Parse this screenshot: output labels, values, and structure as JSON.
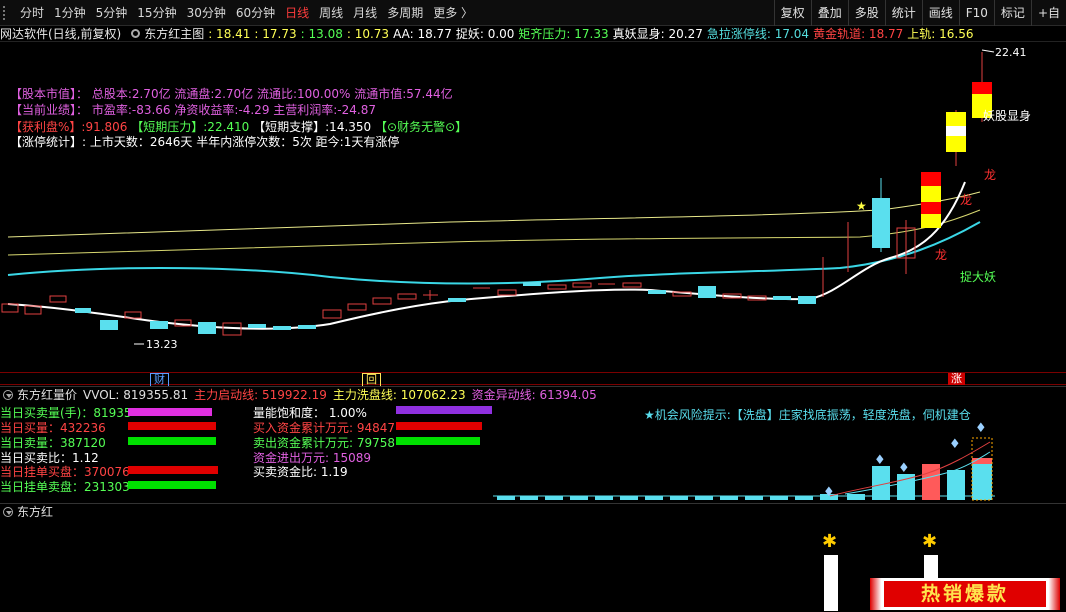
{
  "toolbar": {
    "left_items": [
      "分时",
      "1分钟",
      "5分钟",
      "15分钟",
      "30分钟",
      "60分钟",
      "日线",
      "周线",
      "月线",
      "多周期",
      "更多 〉"
    ],
    "active": "日线",
    "right_items": [
      "复权",
      "叠加",
      "多股",
      "统计",
      "画线",
      "F10",
      "标记",
      "+自"
    ]
  },
  "infobar": {
    "stock": "网达软件(日线,前复权)",
    "indicator": "东方红主图",
    "values": [
      {
        "text": ": 18.41",
        "color": "#ffff55"
      },
      {
        "text": ": 17.73",
        "color": "#ffff55"
      },
      {
        "text": ": 13.08",
        "color": "#55ff55"
      },
      {
        "text": ": 10.73",
        "color": "#ffff55"
      },
      {
        "text": "AA: 18.77",
        "color": "#ffffff"
      },
      {
        "text": "捉妖: 0.00",
        "color": "#ffffff"
      },
      {
        "text": "矩齐压力: 17.33",
        "color": "#55ff55"
      },
      {
        "text": "真妖显身: 20.27",
        "color": "#ffffff"
      },
      {
        "text": "急拉涨停线: 17.04",
        "color": "#55dddd"
      },
      {
        "text": "黄金轨道: 18.77",
        "color": "#ff4444"
      },
      {
        "text": "上轨: 16.56",
        "color": "#ffff55"
      }
    ]
  },
  "main_text": {
    "line1": "【股本市值】：  总股本:2.70亿  流通盘:2.70亿  流通比:100.00%  流通市值:57.44亿",
    "line2": "【当前业绩】：  市盈率:-83.66  净资收益率:-4.29  主营利润率:-24.87",
    "line3a": "【获利盘%】:91.806",
    "line3b": "【短期压力】:22.410",
    "line3c": "【短期支撑】:14.350",
    "line3d": "【⊙财务无警⊙】",
    "line4": "【涨停统计】: 上市天数：2646天  半年内涨停次数：5次   距今:1天有涨停",
    "high_label": "22.41",
    "low_label": "13.23",
    "yao_label": "妖股显身",
    "long1": "龙",
    "long2": "龙",
    "long3": "龙",
    "catch_label": "捉大妖"
  },
  "date_axis": {
    "mark1": "财",
    "mark2": "回",
    "mark3": "涨"
  },
  "vol_header": {
    "title": "东方红量价",
    "vvol": "VVOL: 819355.81",
    "zl_qd": "主力启动线: 519922.19",
    "zl_xp": "主力洗盘线: 107062.23",
    "zj_yd": "资金异动线: 61394.05"
  },
  "vol_stats": {
    "buy_vol": "当日买卖量(手)：81935",
    "buy_qty": "当日买量：432236",
    "sell_qty": "当日卖量：387120",
    "ratio": "当日买卖比：1.12",
    "pend_buy": "当日挂单买盘：370076",
    "pend_sell": "当日挂单卖盘：231303",
    "sat": "量能饱和度：  1.00%",
    "buy_acc": "买入资金累计万元: 94847",
    "sell_acc": "卖出资金累计万元: 79758",
    "flow": "资金进出万元: 15089",
    "bs_ratio": "买卖资金比: 1.19"
  },
  "risk_tip": "★机会风险提示:【洗盘】庄家找底振荡，轻度洗盘，伺机建仓",
  "dfh_header": {
    "title": "东方红"
  },
  "hot_banner": "热销爆款"
}
